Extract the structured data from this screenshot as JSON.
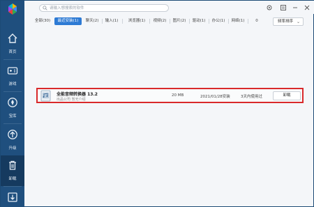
{
  "sidebar": {
    "items": [
      {
        "label": "首页",
        "icon": "home-icon"
      },
      {
        "label": "游戏",
        "icon": "gamepad-icon"
      },
      {
        "label": "宝库",
        "icon": "treasure-icon"
      },
      {
        "label": "升级",
        "icon": "upgrade-icon"
      },
      {
        "label": "卸载",
        "icon": "trash-icon"
      },
      {
        "label": "",
        "icon": "download-icon"
      }
    ],
    "active_index": 4
  },
  "topbar": {
    "search_placeholder": "请输入想搜索的软件",
    "icons": [
      "settings-icon",
      "menu-icon",
      "minimize-icon",
      "close-icon"
    ]
  },
  "tabs": [
    {
      "label": "全部(30)"
    },
    {
      "label": "最近安装(1)"
    },
    {
      "label": "聊天(2)"
    },
    {
      "label": "输入(1)"
    },
    {
      "label": "浏览器(1)"
    },
    {
      "label": "视频(2)"
    },
    {
      "label": "图片(2)"
    },
    {
      "label": "驱动(1)"
    },
    {
      "label": "办公(1)"
    },
    {
      "label": "网络(1)"
    },
    {
      "label": "0"
    }
  ],
  "active_tab": 1,
  "sort": {
    "label": "频率排序"
  },
  "apps": [
    {
      "name": "全能音频转换器 13.2",
      "meta": "出品公司  暂无介绍",
      "size": "20 MB",
      "date": "2021/01/28安装",
      "used": "3天内使用过",
      "action": "卸载"
    }
  ],
  "colors": {
    "accent": "#2d7ad4",
    "sidebar": "#1f4f7e",
    "highlight": "#d9292b"
  }
}
